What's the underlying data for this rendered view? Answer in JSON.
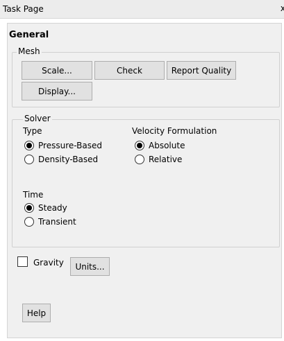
{
  "window": {
    "title": "Task Page",
    "close_glyph": "x"
  },
  "page": {
    "heading": "General"
  },
  "mesh": {
    "label": "Mesh",
    "buttons": {
      "scale": "Scale...",
      "check": "Check",
      "report_quality": "Report Quality",
      "display": "Display..."
    }
  },
  "solver": {
    "label": "Solver",
    "type": {
      "label": "Type",
      "options": [
        {
          "label": "Pressure-Based",
          "selected": true
        },
        {
          "label": "Density-Based",
          "selected": false
        }
      ]
    },
    "velocity_formulation": {
      "label": "Velocity Formulation",
      "options": [
        {
          "label": "Absolute",
          "selected": true
        },
        {
          "label": "Relative",
          "selected": false
        }
      ]
    },
    "time": {
      "label": "Time",
      "options": [
        {
          "label": "Steady",
          "selected": true
        },
        {
          "label": "Transient",
          "selected": false
        }
      ]
    }
  },
  "gravity": {
    "label": "Gravity",
    "checked": false
  },
  "units_button": "Units...",
  "help_button": "Help"
}
